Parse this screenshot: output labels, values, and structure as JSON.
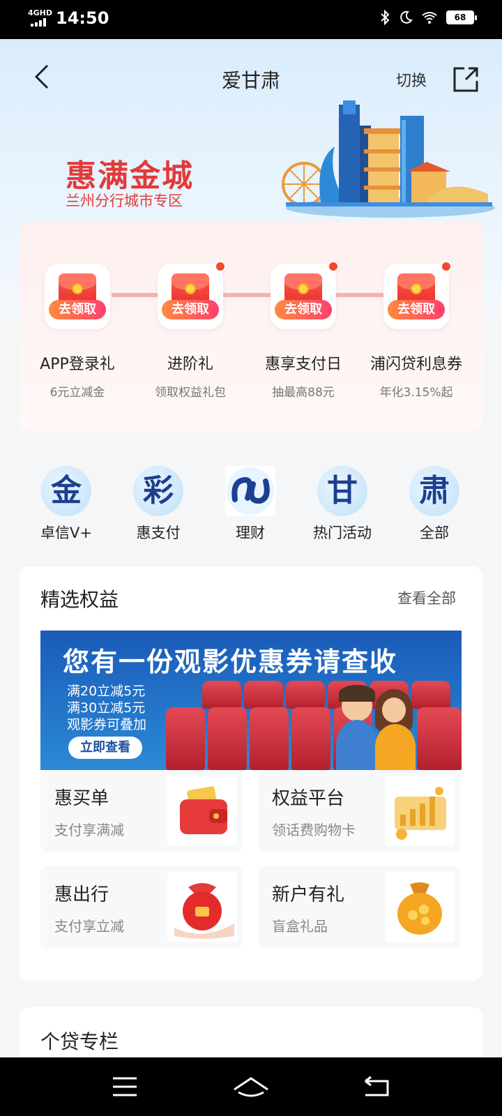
{
  "status": {
    "network": "4GHD",
    "time": "14:50",
    "battery": "68",
    "bluetooth_icon": "bluetooth-icon",
    "moon_icon": "moon-icon",
    "wifi_icon": "wifi-icon"
  },
  "nav": {
    "title": "爱甘肃",
    "switch_label": "切换",
    "back_icon": "chevron-left-icon",
    "share_icon": "share-icon"
  },
  "hero": {
    "title": "惠满金城",
    "subtitle": "兰州分行城市专区",
    "accent": "#e23a3a"
  },
  "gifts": [
    {
      "badge": "去领取",
      "label": "APP登录礼",
      "sub": "6元立减金",
      "dot": false
    },
    {
      "badge": "去领取",
      "label": "进阶礼",
      "sub": "领取权益礼包",
      "dot": true
    },
    {
      "badge": "去领取",
      "label": "惠享支付日",
      "sub": "抽最高88元",
      "dot": true
    },
    {
      "badge": "去领取",
      "label": "浦闪贷利息券",
      "sub": "年化3.15%起",
      "dot": true
    }
  ],
  "quick": [
    {
      "glyph": "金",
      "label": "卓信V+"
    },
    {
      "glyph": "彩",
      "label": "惠支付"
    },
    {
      "glyph": "",
      "label": "理财"
    },
    {
      "glyph": "甘",
      "label": "热门活动"
    },
    {
      "glyph": "肃",
      "label": "全部"
    }
  ],
  "benefits": {
    "title": "精选权益",
    "more": "查看全部",
    "banner": {
      "headline": "您有一份观影优惠券请查收",
      "lines": [
        "满20立减5元",
        "满30立减5元",
        "观影券可叠加"
      ],
      "button": "立即查看"
    },
    "tiles": [
      {
        "title": "惠买单",
        "sub": "支付享满减",
        "icon": "wallet-icon"
      },
      {
        "title": "权益平台",
        "sub": "领话费购物卡",
        "icon": "gift-card-icon"
      },
      {
        "title": "惠出行",
        "sub": "支付享立减",
        "icon": "red-pouch-icon"
      },
      {
        "title": "新户有礼",
        "sub": "盲盒礼品",
        "icon": "coin-bag-icon"
      }
    ]
  },
  "loan": {
    "title": "个贷专栏"
  },
  "system_nav": {
    "menu_icon": "menu-icon",
    "home_icon": "home-icon",
    "back_icon": "back-icon"
  }
}
